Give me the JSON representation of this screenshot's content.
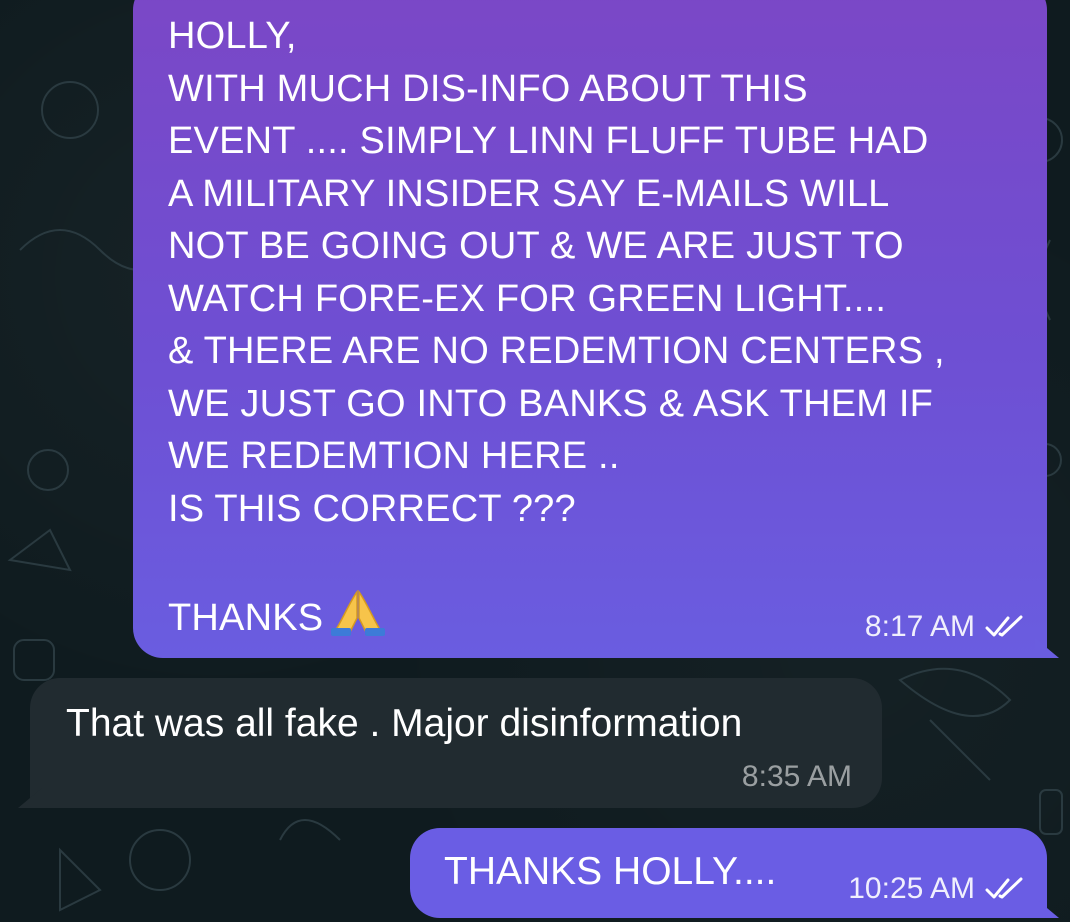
{
  "conversation": {
    "messages": [
      {
        "direction": "outgoing",
        "text": "HOLLY,\nWITH MUCH DIS-INFO ABOUT THIS\nEVENT .... SIMPLY LINN FLUFF TUBE HAD\nA MILITARY INSIDER SAY E-MAILS WILL\nNOT BE GOING OUT & WE ARE JUST TO\nWATCH FORE-EX FOR GREEN LIGHT....\n& THERE ARE NO REDEMTION CENTERS ,\nWE JUST GO INTO BANKS & ASK THEM IF\nWE REDEMTION HERE ..\nIS THIS CORRECT ???\n\nTHANKS",
        "emoji": "folded-hands-emoji",
        "time": "8:17 AM",
        "status": "read-double-check"
      },
      {
        "direction": "incoming",
        "text": "That was all fake . Major disinformation",
        "time": "8:35 AM"
      },
      {
        "direction": "outgoing",
        "text": "THANKS HOLLY....",
        "time": "10:25 AM",
        "status": "read-double-check"
      }
    ]
  },
  "colors": {
    "background": "#0f1b1f",
    "outgoing_bubble_top": "#7b47c6",
    "outgoing_bubble_bottom": "#6a5de0",
    "incoming_bubble": "#212b30",
    "text": "#ffffff"
  }
}
